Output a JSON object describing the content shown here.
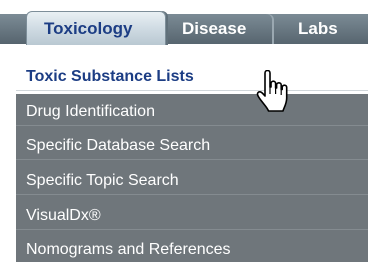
{
  "tabs": [
    {
      "label": "Toxicology",
      "active": true
    },
    {
      "label": "Disease",
      "active": false
    },
    {
      "label": "Labs",
      "active": false
    }
  ],
  "menu": {
    "items": [
      {
        "label": "Toxic Substance Lists",
        "active": true
      },
      {
        "label": "Drug Identification",
        "active": false
      },
      {
        "label": "Specific Database Search",
        "active": false
      },
      {
        "label": "Specific Topic Search",
        "active": false
      },
      {
        "label": "VisualDx®",
        "active": false
      },
      {
        "label": "Nomograms and References",
        "active": false
      }
    ]
  },
  "cursor": {
    "icon": "hand-pointer-icon"
  },
  "colors": {
    "active_text": "#1c3d84",
    "menu_background": "#6f767b",
    "inactive_tab": "#5f6d77",
    "active_tab": "#cdd9e1"
  }
}
